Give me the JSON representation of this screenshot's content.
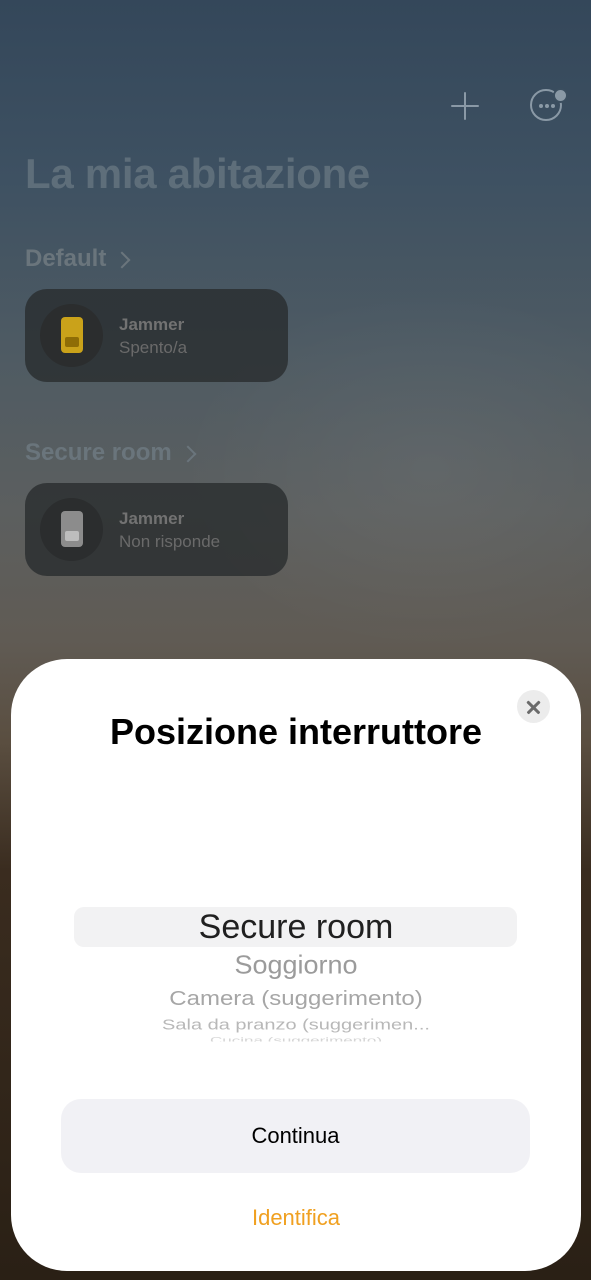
{
  "home": {
    "title": "La mia abitazione",
    "sections": [
      {
        "name": "Default",
        "accessory": {
          "name": "Jammer",
          "status": "Spento/a",
          "icon": "light-switch-icon",
          "icon_color": "#caa21a"
        }
      },
      {
        "name": "Secure room",
        "accessory": {
          "name": "Jammer",
          "status": "Non risponde",
          "icon": "light-switch-icon",
          "icon_color": "#8c8c8c"
        }
      }
    ]
  },
  "toolbar": {
    "add_icon": "plus-icon",
    "more_icon": "ellipsis-circle-icon"
  },
  "sheet": {
    "title": "Posizione interruttore",
    "picker": {
      "selected": "Secure room",
      "options": [
        "Secure room",
        "Soggiorno",
        "Camera (suggerimento)",
        "Sala da pranzo (suggerimen...",
        "Cucina (suggerimento)"
      ]
    },
    "continue_label": "Continua",
    "identify_label": "Identifica",
    "accent_color": "#f0a020"
  }
}
